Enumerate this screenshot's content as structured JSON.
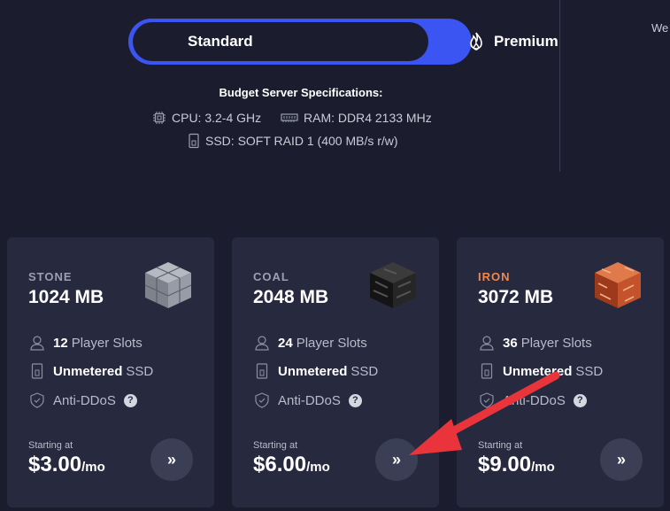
{
  "plan_toggle": {
    "standard_label": "Standard",
    "premium_label": "Premium"
  },
  "side_text": "We",
  "specs": {
    "title": "Budget Server Specifications:",
    "cpu": "CPU: 3.2-4 GHz",
    "ram": "RAM: DDR4 2133 MHz",
    "ssd": "SSD: SOFT RAID 1 (400 MB/s r/w)"
  },
  "plans": [
    {
      "tier": "STONE",
      "memory": "1024 MB",
      "slots_count": "12",
      "slots_label": "Player Slots",
      "ssd_bold": "Unmetered",
      "ssd_label": "SSD",
      "ddos_label": "Anti-DDoS",
      "help": "?",
      "starting_label": "Starting at",
      "price": "$3.00",
      "per": "/mo",
      "go_label": "»",
      "cube_color": "#8a8f99"
    },
    {
      "tier": "COAL",
      "memory": "2048 MB",
      "slots_count": "24",
      "slots_label": "Player Slots",
      "ssd_bold": "Unmetered",
      "ssd_label": "SSD",
      "ddos_label": "Anti-DDoS",
      "help": "?",
      "starting_label": "Starting at",
      "price": "$6.00",
      "per": "/mo",
      "go_label": "»",
      "cube_color": "#2a2a2a"
    },
    {
      "tier": "IRON",
      "memory": "3072 MB",
      "slots_count": "36",
      "slots_label": "Player Slots",
      "ssd_bold": "Unmetered",
      "ssd_label": "SSD",
      "ddos_label": "Anti-DDoS",
      "help": "?",
      "starting_label": "Starting at",
      "price": "$9.00",
      "per": "/mo",
      "go_label": "»",
      "cube_color": "#c9552c"
    }
  ],
  "colors": {
    "background": "#1b1d2e",
    "card": "#272a3e",
    "accent": "#3b55f2",
    "iron": "#f0874e",
    "arrow": "#e8343a"
  }
}
